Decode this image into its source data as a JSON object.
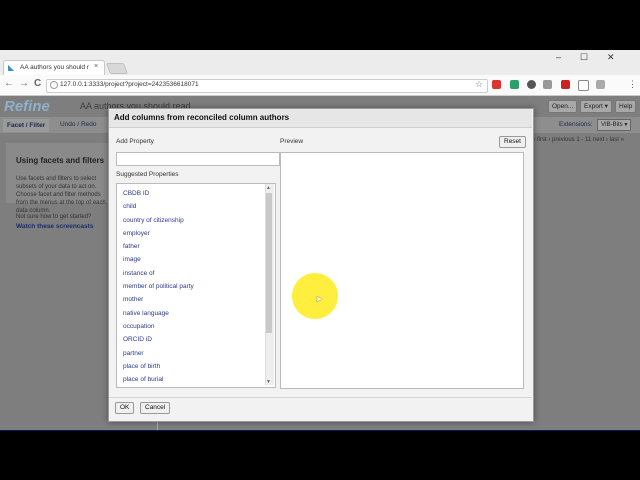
{
  "browser": {
    "tab_title": "AA authors you should r",
    "tab_close": "×",
    "url": "127.0.0.1:3333/project?project=2423536618071",
    "window_controls": {
      "minimize": "–",
      "maximize": "☐",
      "close": "✕"
    },
    "nav": {
      "back": "←",
      "forward": "→",
      "reload": "C"
    },
    "star": "☆"
  },
  "app": {
    "logo": "Refine",
    "project_title": "AA authors you should read",
    "header_buttons": [
      "Open...",
      "Export ▾",
      "Help"
    ],
    "left_tab": "Facet / Filter",
    "undo_tab": "Undo / Redo",
    "extensions_label": "Extensions:",
    "extensions_button": "VIB-Bits ▾",
    "left_panel": {
      "heading": "Using facets and filters",
      "text": "Use facets and filters to select subsets of your data to act on. Choose facet and filter methods from the menus at the top of each data column.",
      "question": "Not sure how to get started?",
      "link": "Watch these screencasts"
    },
    "pager": "« first  ‹ previous  1 - 11  next ›  last »"
  },
  "dialog": {
    "title": "Add columns from reconciled column authors",
    "add_property_label": "Add Property",
    "add_property_value": "",
    "suggested_label": "Suggested Properties",
    "properties": [
      "CBDB ID",
      "child",
      "country of citizenship",
      "employer",
      "father",
      "image",
      "instance of",
      "member of political party",
      "mother",
      "native language",
      "occupation",
      "ORCID iD",
      "partner",
      "place of birth",
      "place of burial"
    ],
    "preview_label": "Preview",
    "reset_button": "Reset",
    "ok_button": "OK",
    "cancel_button": "Cancel"
  },
  "colors": {
    "link": "#2a3a8a",
    "highlight": "#ffec28",
    "dialog_bg": "#f2f2f2",
    "overlay": "#7e7e7e"
  }
}
